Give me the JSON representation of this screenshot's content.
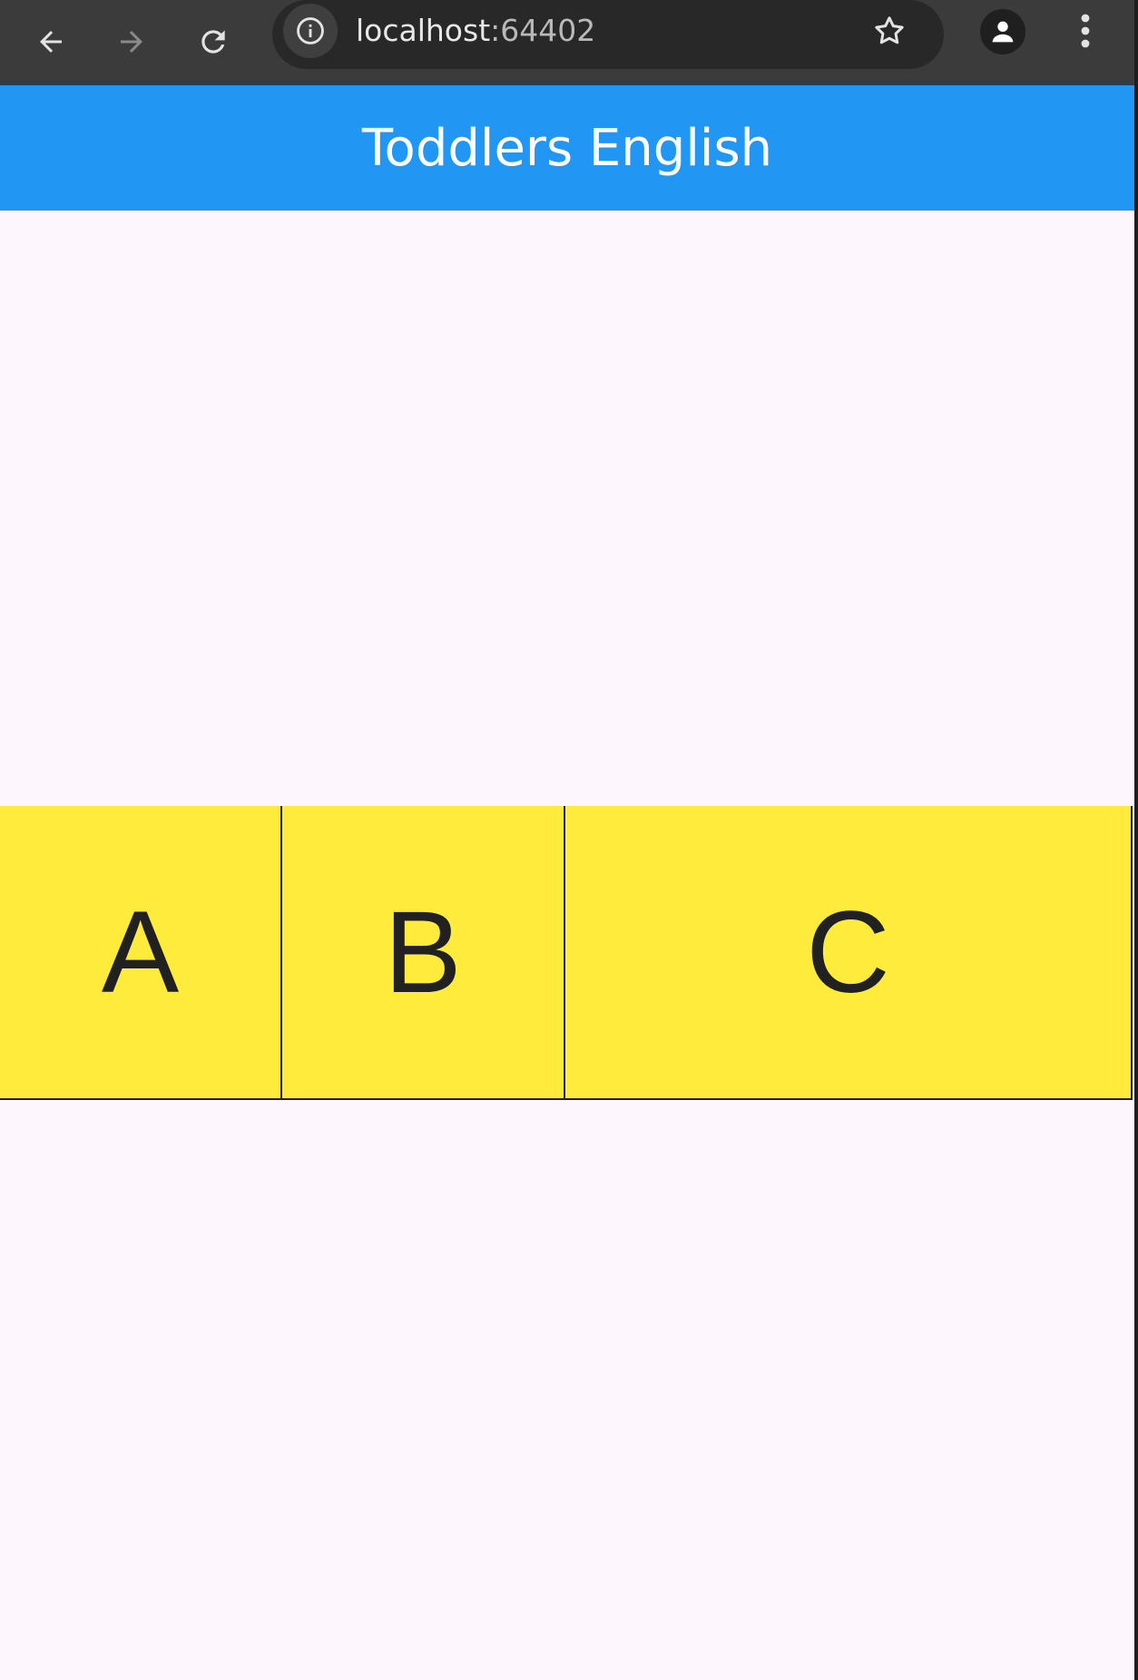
{
  "browser": {
    "url_host": "localhost",
    "url_port": ":64402",
    "icons": {
      "back": "back-arrow-icon",
      "forward": "forward-arrow-icon",
      "reload": "reload-icon",
      "site_info": "info-icon",
      "bookmark": "star-icon",
      "profile": "person-icon",
      "menu": "more-vert-icon"
    }
  },
  "app_bar": {
    "title": "Toddlers English",
    "color": "#2196f3"
  },
  "letters": [
    {
      "label": "A"
    },
    {
      "label": "B"
    },
    {
      "label": "C"
    }
  ],
  "colors": {
    "letter_tile": "#ffeb3b",
    "page_background": "#fdf7fd"
  }
}
